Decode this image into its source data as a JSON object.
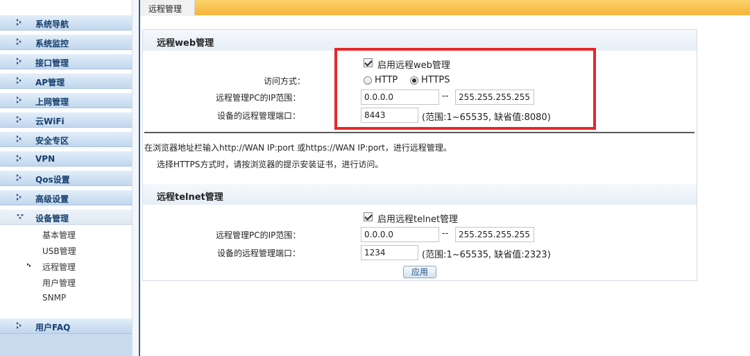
{
  "sidebar": {
    "items": [
      {
        "label": "系统导航"
      },
      {
        "label": "系统监控"
      },
      {
        "label": "接口管理"
      },
      {
        "label": "AP管理"
      },
      {
        "label": "上网管理"
      },
      {
        "label": "云WiFi"
      },
      {
        "label": "安全专区"
      },
      {
        "label": "VPN"
      },
      {
        "label": "Qos设置"
      },
      {
        "label": "高级设置"
      },
      {
        "label": "设备管理"
      }
    ],
    "sub_items": [
      {
        "label": "基本管理"
      },
      {
        "label": "USB管理"
      },
      {
        "label": "远程管理"
      },
      {
        "label": "用户管理"
      },
      {
        "label": "SNMP"
      }
    ],
    "faq": {
      "label": "用户FAQ"
    }
  },
  "tab": {
    "label": "远程管理"
  },
  "web_section": {
    "title": "远程web管理",
    "enable_label": "启用远程web管理",
    "enabled": true,
    "access_label": "访问方式：",
    "options": [
      "HTTP",
      "HTTPS"
    ],
    "selected": "HTTPS",
    "ip_range_label": "远程管理PC的IP范围：",
    "ip_start": "0.0.0.0",
    "range_sep": "--",
    "ip_end": "255.255.255.255",
    "port_label": "设备的远程管理端口：",
    "port": "8443",
    "port_hint": "(范围:1~65535, 缺省值:8080)"
  },
  "notes": {
    "line1": "在浏览器地址栏输入http://WAN IP:port 或https://WAN IP:port，进行远程管理。",
    "line2": "选择HTTPS方式时，请按浏览器的提示安装证书，进行访问。"
  },
  "telnet_section": {
    "title": "远程telnet管理",
    "enable_label": "启用远程telnet管理",
    "enabled": true,
    "ip_range_label": "远程管理PC的IP范围：",
    "ip_start": "0.0.0.0",
    "range_sep": "--",
    "ip_end": "255.255.255.255",
    "port_label": "设备的远程管理端口：",
    "port": "1234",
    "port_hint": "(范围:1~65535, 缺省值:2323)"
  },
  "apply_button": "应用",
  "colors": {
    "highlight": "#e8262a",
    "tabbar": "#f7b43a",
    "nav_text": "#163e6b"
  }
}
